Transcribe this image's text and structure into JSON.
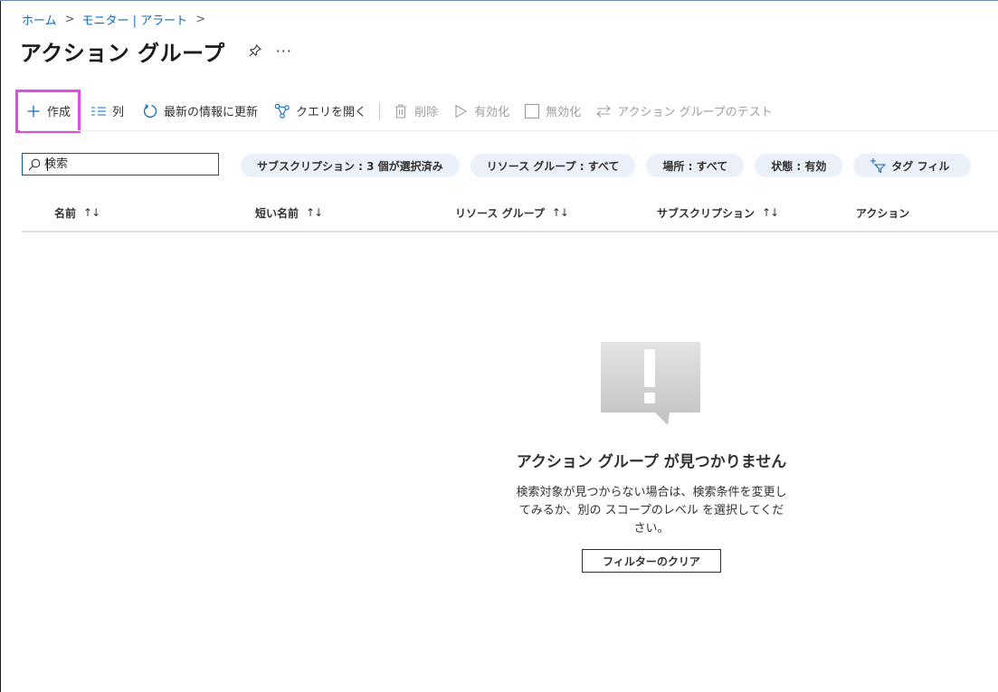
{
  "breadcrumb": {
    "items": [
      {
        "label": "ホーム"
      },
      {
        "label": "モニター | アラート"
      }
    ],
    "separator": ">"
  },
  "header": {
    "title": "アクション グループ",
    "more_label": "···"
  },
  "toolbar": {
    "create": "作成",
    "columns": "列",
    "refresh": "最新の情報に更新",
    "open_query": "クエリを開く",
    "delete": "削除",
    "enable": "有効化",
    "disable": "無効化",
    "test": "アクション グループのテスト"
  },
  "search": {
    "placeholder": "検索"
  },
  "filters": {
    "subscription": "サブスクリプション : 3 個が選択済み",
    "resource_group": "リソース グループ : すべて",
    "location": "場所 : すべて",
    "status": "状態 : 有効",
    "tag_filter": "タグ フィル"
  },
  "table": {
    "columns": [
      {
        "label": "名前",
        "sort": "↑↓"
      },
      {
        "label": "短い名前",
        "sort": "↑↓"
      },
      {
        "label": "リソース グループ",
        "sort": "↑↓"
      },
      {
        "label": "サブスクリプション",
        "sort": "↑↓"
      },
      {
        "label": "アクション"
      }
    ]
  },
  "empty_state": {
    "title": "アクション グループ が見つかりません",
    "description": "検索対象が見つからない場合は、検索条件を変更してみるか、別の スコープのレベル を選択してください。",
    "clear_button": "フィルターのクリア"
  },
  "colors": {
    "accent": "#0f6cbd",
    "highlight": "#e04ce8",
    "pill_bg": "#eaf1f9",
    "disabled": "#a19f9d"
  }
}
